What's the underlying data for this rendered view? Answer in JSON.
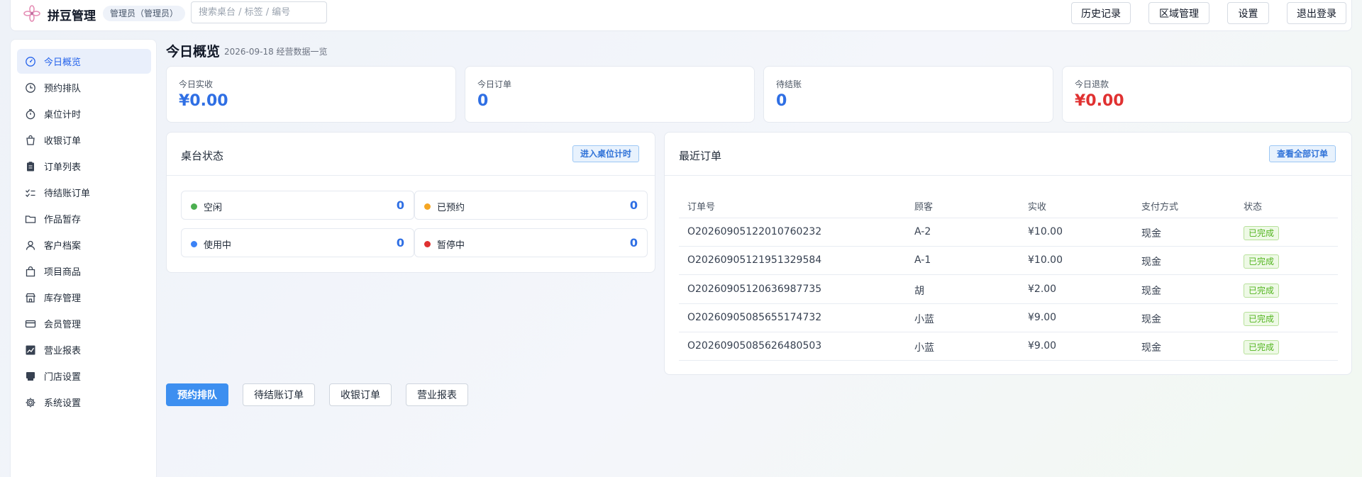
{
  "header": {
    "app_title": "拼豆管理",
    "role_badge": "管理员（管理员）",
    "search_placeholder": "搜索桌台 / 标签 / 编号",
    "buttons": [
      "历史记录",
      "区域管理",
      "设置",
      "退出登录"
    ]
  },
  "sidebar": {
    "items": [
      {
        "label": "今日概览",
        "icon": "dashboard-icon",
        "active": true
      },
      {
        "label": "预约排队",
        "icon": "clock-icon"
      },
      {
        "label": "桌位计时",
        "icon": "timer-icon"
      },
      {
        "label": "收银订单",
        "icon": "cart-icon"
      },
      {
        "label": "订单列表",
        "icon": "clipboard-icon"
      },
      {
        "label": "待结账订单",
        "icon": "checklist-icon"
      },
      {
        "label": "作品暂存",
        "icon": "folder-icon"
      },
      {
        "label": "客户档案",
        "icon": "user-icon"
      },
      {
        "label": "项目商品",
        "icon": "bag-icon"
      },
      {
        "label": "库存管理",
        "icon": "store-icon"
      },
      {
        "label": "会员管理",
        "icon": "card-icon"
      },
      {
        "label": "营业报表",
        "icon": "chart-icon"
      },
      {
        "label": "门店设置",
        "icon": "shop-icon"
      },
      {
        "label": "系统设置",
        "icon": "gear-icon"
      }
    ]
  },
  "main": {
    "title": "今日概览",
    "subtitle": "2026-09-18 经营数据一览",
    "stats": [
      {
        "label": "今日实收",
        "value": "¥0.00",
        "color": "#2f6fe4"
      },
      {
        "label": "今日订单",
        "value": "0",
        "color": "#2f6fe4"
      },
      {
        "label": "待结账",
        "value": "0",
        "color": "#2f6fe4"
      },
      {
        "label": "今日退款",
        "value": "¥0.00",
        "color": "#e03131"
      }
    ],
    "table_status": {
      "title": "桌台状态",
      "action": "进入桌位计时",
      "items": [
        {
          "label": "空闲",
          "count": "0",
          "color": "#4caf50"
        },
        {
          "label": "已预约",
          "count": "0",
          "color": "#f5a623"
        },
        {
          "label": "使用中",
          "count": "0",
          "color": "#3b82f6"
        },
        {
          "label": "暂停中",
          "count": "0",
          "color": "#e03131"
        }
      ]
    },
    "recent_orders": {
      "title": "最近订单",
      "action": "查看全部订单",
      "columns": [
        "订单号",
        "顾客",
        "实收",
        "支付方式",
        "状态"
      ],
      "rows": [
        [
          "O20260905122010760232",
          "A-2",
          "¥10.00",
          "现金",
          "已完成"
        ],
        [
          "O20260905121951329584",
          "A-1",
          "¥10.00",
          "现金",
          "已完成"
        ],
        [
          "O20260905120636987735",
          "胡",
          "¥2.00",
          "现金",
          "已完成"
        ],
        [
          "O20260905085655174732",
          "小蓝",
          "¥9.00",
          "现金",
          "已完成"
        ],
        [
          "O20260905085626480503",
          "小蓝",
          "¥9.00",
          "现金",
          "已完成"
        ]
      ]
    },
    "quick_actions": [
      "预约排队",
      "待结账订单",
      "收银订单",
      "营业报表"
    ]
  }
}
